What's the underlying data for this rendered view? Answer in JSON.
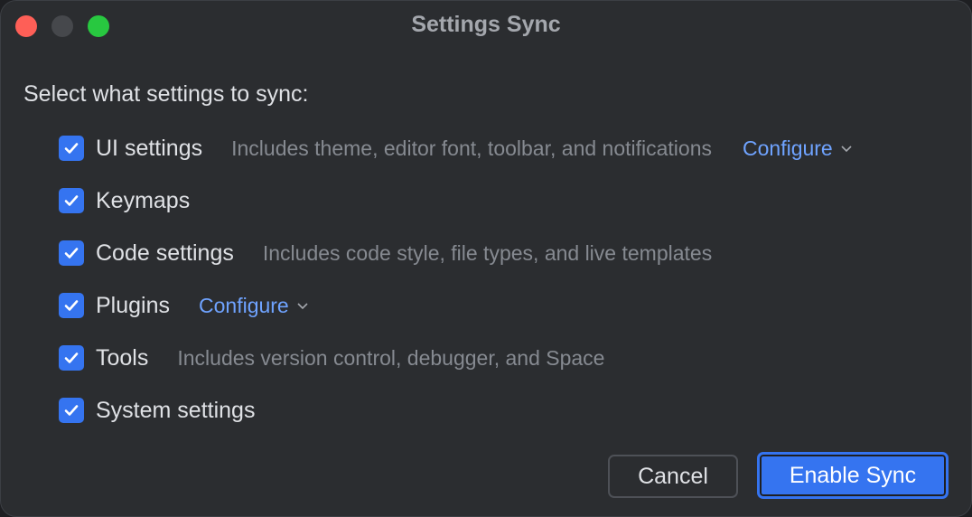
{
  "window": {
    "title": "Settings Sync"
  },
  "prompt": "Select what settings to sync:",
  "items": [
    {
      "label": "UI settings",
      "checked": true,
      "description": "Includes theme, editor font, toolbar, and notifications",
      "configure": "Configure"
    },
    {
      "label": "Keymaps",
      "checked": true
    },
    {
      "label": "Code settings",
      "checked": true,
      "description": "Includes code style, file types, and live templates"
    },
    {
      "label": "Plugins",
      "checked": true,
      "configure": "Configure"
    },
    {
      "label": "Tools",
      "checked": true,
      "description": "Includes version control, debugger, and Space"
    },
    {
      "label": "System settings",
      "checked": true
    }
  ],
  "buttons": {
    "cancel": "Cancel",
    "enable": "Enable Sync"
  },
  "colors": {
    "accent": "#3574f0",
    "link": "#6fa3ff"
  }
}
